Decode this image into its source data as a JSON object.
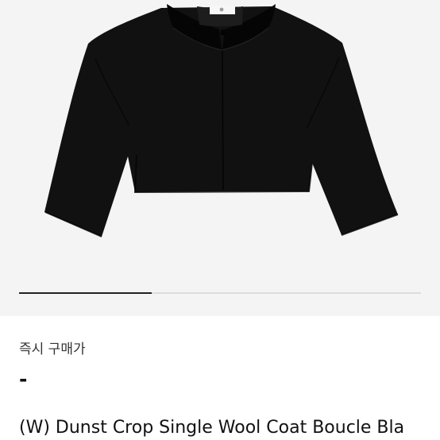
{
  "product": {
    "image_icon": "black-cropped-wool-coat-photo",
    "image_background": "#f4f4f4",
    "gallery_progress": 0.33,
    "buy_now_label": "즉시 구매가",
    "price": "-",
    "title": "(W) Dunst Crop Single Wool Coat Boucle Bla"
  },
  "colors": {
    "background": "#ffffff",
    "text": "#111111",
    "muted_text": "#333333",
    "coat": "#111111",
    "progress_track": "#dcdcdc",
    "progress_fill": "#222222"
  }
}
